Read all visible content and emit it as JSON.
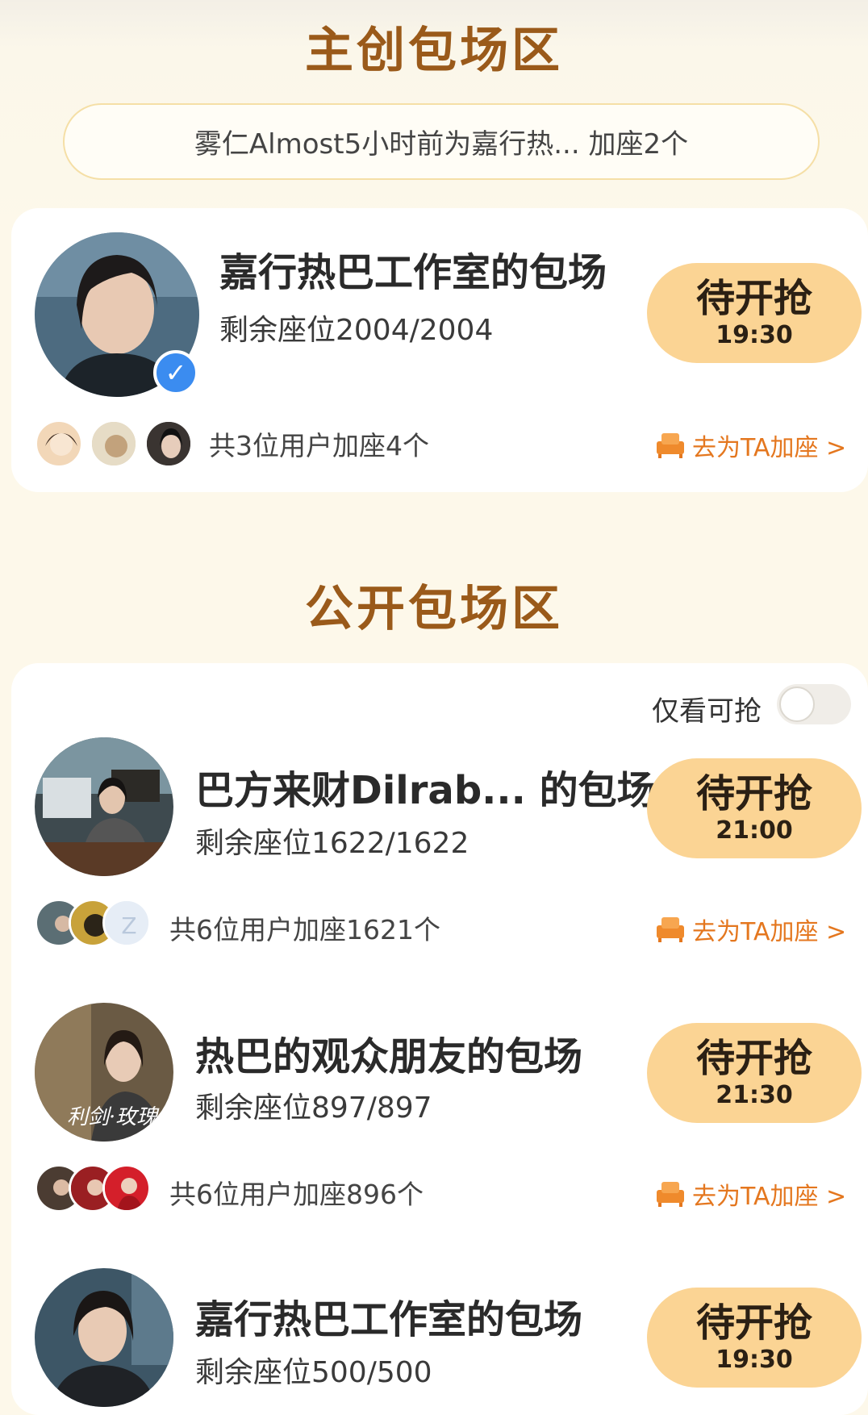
{
  "sections": {
    "creator_title": "主创包场区",
    "public_title": "公开包场区"
  },
  "notice": "雾仁Almost5小时前为嘉行热... 加座2个",
  "creator_card": {
    "title": "嘉行热巴工作室的包场",
    "seats": "剩余座位2004/2004",
    "button_label": "待开抢",
    "button_time": "19:30",
    "users_text": "共3位用户加座4个",
    "add_link": "去为TA加座 >",
    "verified_icon": "checkmark"
  },
  "filter": {
    "label": "仅看可抢",
    "enabled": false
  },
  "public_cards": [
    {
      "title": "巴方来财Dilrab... 的包场",
      "seats": "剩余座位1622/1622",
      "button_label": "待开抢",
      "button_time": "21:00",
      "users_text": "共6位用户加座1621个",
      "add_link": "去为TA加座 >"
    },
    {
      "title": "热巴的观众朋友的包场",
      "seats": "剩余座位897/897",
      "button_label": "待开抢",
      "button_time": "21:30",
      "users_text": "共6位用户加座896个",
      "add_link": "去为TA加座 >"
    },
    {
      "title": "嘉行热巴工作室的包场",
      "seats": "剩余座位500/500",
      "button_label": "待开抢",
      "button_time": "19:30"
    }
  ],
  "colors": {
    "accent": "#e4771f",
    "title_brown": "#9a5a1a",
    "button_bg": "#fbd494",
    "verified_blue": "#3b8cf0"
  }
}
